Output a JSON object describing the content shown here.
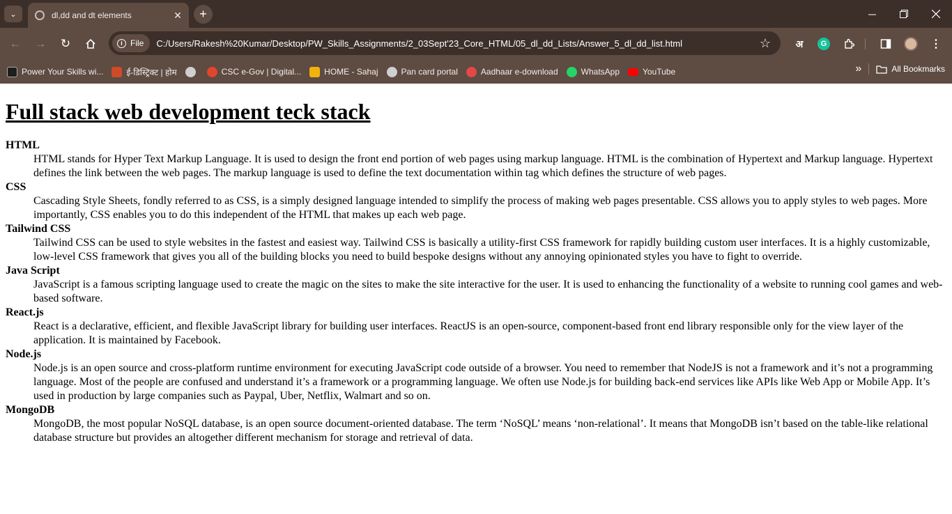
{
  "browser": {
    "tab_title": "dl,dd and dt elements",
    "new_tab_symbol": "+",
    "close_symbol": "✕",
    "url_chip": "File",
    "url": "C:/Users/Rakesh%20Kumar/Desktop/PW_Skills_Assignments/2_03Sept'23_Core_HTML/05_dl_dd_Lists/Answer_5_dl_dd_list.html",
    "ext_hindi": "अ",
    "ext_grammarly": "G"
  },
  "bookmarks": {
    "items": [
      {
        "label": "Power Your Skills wi...",
        "color": "#1e1e1e"
      },
      {
        "label": "ई-डिस्ट्रिक्ट | होम",
        "color": "#d04a2a"
      },
      {
        "label": "",
        "color": "#cfcfcf"
      },
      {
        "label": "CSC e-Gov | Digital...",
        "color": "#e2452b"
      },
      {
        "label": "HOME - Sahaj",
        "color": "#f2b10c"
      },
      {
        "label": "Pan card portal",
        "color": "#cfcfcf"
      },
      {
        "label": "Aadhaar e-download",
        "color": "#e34848"
      },
      {
        "label": "WhatsApp",
        "color": "#25d366"
      },
      {
        "label": "YouTube",
        "color": "#ff0000"
      }
    ],
    "more": "»",
    "all_bookmarks": "All Bookmarks"
  },
  "page": {
    "heading": "Full stack web development teck stack",
    "entries": [
      {
        "term": "HTML",
        "definition": "HTML stands for Hyper Text Markup Language. It is used to design the front end portion of web pages using markup language. HTML is the combination of Hypertext and Markup language. Hypertext defines the link between the web pages. The markup language is used to define the text documentation within tag which defines the structure of web pages."
      },
      {
        "term": "CSS",
        "definition": "Cascading Style Sheets, fondly referred to as CSS, is a simply designed language intended to simplify the process of making web pages presentable. CSS allows you to apply styles to web pages. More importantly, CSS enables you to do this independent of the HTML that makes up each web page."
      },
      {
        "term": "Tailwind CSS",
        "definition": "Tailwind CSS can be used to style websites in the fastest and easiest way. Tailwind CSS is basically a utility-first CSS framework for rapidly building custom user interfaces. It is a highly customizable, low-level CSS framework that gives you all of the building blocks you need to build bespoke designs without any annoying opinionated styles you have to fight to override."
      },
      {
        "term": "Java Script",
        "definition": "JavaScript is a famous scripting language used to create the magic on the sites to make the site interactive for the user. It is used to enhancing the functionality of a website to running cool games and web-based software."
      },
      {
        "term": "React.js",
        "definition": "React is a declarative, efficient, and flexible JavaScript library for building user interfaces. ReactJS is an open-source, component-based front end library responsible only for the view layer of the application. It is maintained by Facebook."
      },
      {
        "term": "Node.js",
        "definition": "Node.js is an open source and cross-platform runtime environment for executing JavaScript code outside of a browser. You need to remember that NodeJS is not a framework and it’s not a programming language. Most of the people are confused and understand it’s a framework or a programming language. We often use Node.js for building back-end services like APIs like Web App or Mobile App. It’s used in production by large companies such as Paypal, Uber, Netflix, Walmart and so on."
      },
      {
        "term": "MongoDB",
        "definition": "MongoDB, the most popular NoSQL database, is an open source document-oriented database. The term ‘NoSQL’ means ‘non-relational’. It means that MongoDB isn’t based on the table-like relational database structure but provides an altogether different mechanism for storage and retrieval of data."
      }
    ]
  }
}
